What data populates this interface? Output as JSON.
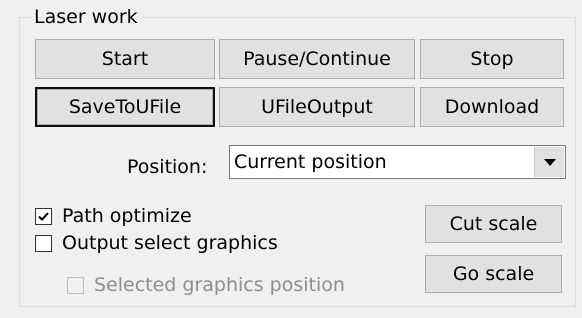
{
  "group": {
    "title": "Laser work"
  },
  "buttons": {
    "start": "Start",
    "pause_continue": "Pause/Continue",
    "stop": "Stop",
    "save_to_ufile": "SaveToUFile",
    "ufile_output": "UFileOutput",
    "download": "Download",
    "cut_scale": "Cut scale",
    "go_scale": "Go scale"
  },
  "position": {
    "label": "Position:",
    "selected": "Current position"
  },
  "options": {
    "path_optimize": {
      "label": "Path optimize",
      "checked": true
    },
    "output_select_graphics": {
      "label": "Output select graphics",
      "checked": false
    },
    "selected_graphics_position": {
      "label": "Selected graphics position",
      "checked": false,
      "disabled": true
    }
  }
}
